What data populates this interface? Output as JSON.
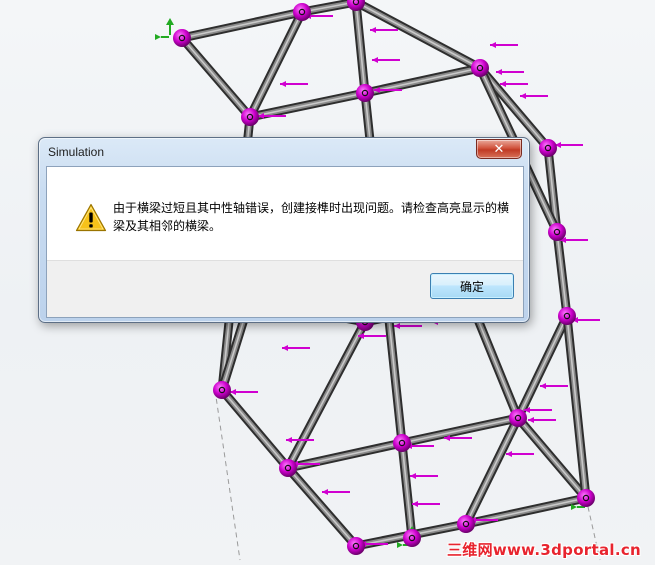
{
  "viewport": {
    "scene": "solidworks-simulation-truss-model",
    "member_color": "#4a4a4a",
    "joint_color": "#cc00cc",
    "load_arrow_color": "#d000d0",
    "fixture_color": "#22aa22"
  },
  "dialog": {
    "title": "Simulation",
    "close_glyph": "✕",
    "icon": "warning-icon",
    "message": "由于横梁过短且其中性轴错误，创建接榫时出现问题。请检查高亮显示的横梁及其相邻的横梁。",
    "ok_label": "确定"
  },
  "watermark": {
    "text": "三维网www.3dportal.cn",
    "color": "#e8242e"
  }
}
